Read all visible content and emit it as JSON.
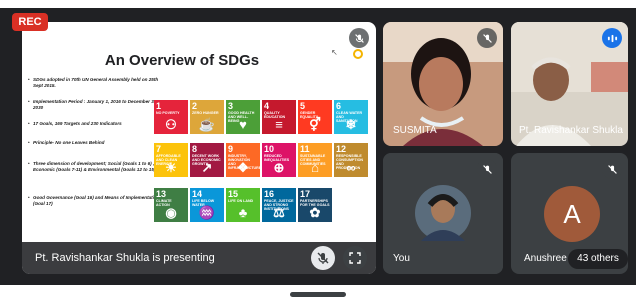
{
  "recording": {
    "label": "REC"
  },
  "slide": {
    "title": "An Overview of SDGs",
    "bullets": [
      "SDGs adopted in 70th UN General Assembly held on 25th Sept 2015.",
      "Implementation Period : January 1, 2016 to December 31, 2030",
      "17 Goals, 169 Targets and 230 Indicators",
      "Principle- No one Leaves Behind",
      "Three dimension of development; Social (Goals 1 to 6) , Economic (Goals 7-11) & Environmental (Goals 12 to 15)",
      "Good Governance (Goal 16) and Means of Implementation (Goal 17)"
    ],
    "goals": [
      {
        "num": "1",
        "name": "NO POVERTY",
        "color": "#e5243b",
        "icon": "people-icon",
        "glyph": "⚇"
      },
      {
        "num": "2",
        "name": "ZERO HUNGER",
        "color": "#dda63a",
        "icon": "bowl-icon",
        "glyph": "☕"
      },
      {
        "num": "3",
        "name": "GOOD HEALTH AND WELL-BEING",
        "color": "#4c9f38",
        "icon": "heartbeat-icon",
        "glyph": "♥"
      },
      {
        "num": "4",
        "name": "QUALITY EDUCATION",
        "color": "#c5192d",
        "icon": "book-icon",
        "glyph": "≡"
      },
      {
        "num": "5",
        "name": "GENDER EQUALITY",
        "color": "#ff3a21",
        "icon": "gender-icon",
        "glyph": "⚥"
      },
      {
        "num": "6",
        "name": "CLEAN WATER AND SANITATION",
        "color": "#26bde2",
        "icon": "water-icon",
        "glyph": "❄"
      },
      {
        "num": "7",
        "name": "AFFORDABLE AND CLEAN ENERGY",
        "color": "#fcc30b",
        "icon": "sun-icon",
        "glyph": "☀"
      },
      {
        "num": "8",
        "name": "DECENT WORK AND ECONOMIC GROWTH",
        "color": "#a21942",
        "icon": "growth-chart-icon",
        "glyph": "↗"
      },
      {
        "num": "9",
        "name": "INDUSTRY, INNOVATION AND INFRASTRUCTURE",
        "color": "#fd6925",
        "icon": "cubes-icon",
        "glyph": "❖"
      },
      {
        "num": "10",
        "name": "REDUCED INEQUALITIES",
        "color": "#dd1367",
        "icon": "equal-icon",
        "glyph": "⊕"
      },
      {
        "num": "11",
        "name": "SUSTAINABLE CITIES AND COMMUNITIES",
        "color": "#fd9d24",
        "icon": "buildings-icon",
        "glyph": "⌂"
      },
      {
        "num": "12",
        "name": "RESPONSIBLE CONSUMPTION AND PRODUCTION",
        "color": "#bf8b2e",
        "icon": "infinity-icon",
        "glyph": "∞"
      },
      {
        "num": "13",
        "name": "CLIMATE ACTION",
        "color": "#3f7e44",
        "icon": "eye-earth-icon",
        "glyph": "◉"
      },
      {
        "num": "14",
        "name": "LIFE BELOW WATER",
        "color": "#0a97d9",
        "icon": "fish-icon",
        "glyph": "♒"
      },
      {
        "num": "15",
        "name": "LIFE ON LAND",
        "color": "#56c02b",
        "icon": "tree-icon",
        "glyph": "♣"
      },
      {
        "num": "16",
        "name": "PEACE, JUSTICE AND STRONG INSTITUTIONS",
        "color": "#00689d",
        "icon": "dove-icon",
        "glyph": "⚖"
      },
      {
        "num": "17",
        "name": "PARTNERSHIPS FOR THE GOALS",
        "color": "#19486a",
        "icon": "flower-icon",
        "glyph": "✿"
      }
    ]
  },
  "presenting": {
    "label": "Pt. Ravishankar Shukla is presenting"
  },
  "participants": [
    {
      "name": "SUSMITA",
      "mic": "muted",
      "bg": "#b06a5a"
    },
    {
      "name": "Pt. Ravishankar Shukla",
      "mic": "speaking",
      "bg": "#9a8f86"
    },
    {
      "name": "You",
      "mic": "muted",
      "bg": "#3c4043"
    },
    {
      "name": "Anushree",
      "mic": "muted",
      "avatar_letter": "A",
      "bg": "#3c4043"
    }
  ],
  "others": {
    "label": "43 others"
  },
  "colors": {
    "meet_bg": "#202124",
    "tile_bg": "#3c4043",
    "rec_red": "#d93025",
    "speaking_blue": "#1a73e8"
  }
}
